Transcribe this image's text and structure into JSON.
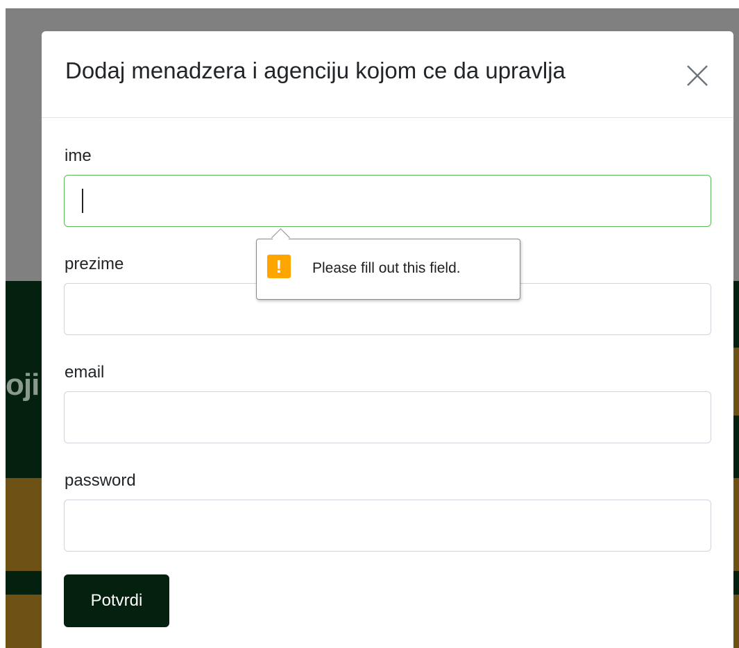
{
  "background": {
    "partial_heading": "oji"
  },
  "modal": {
    "title": "Dodaj menadzera i agenciju kojom ce da upravlja",
    "close_icon": "close-icon",
    "fields": [
      {
        "label": "ime",
        "value": "",
        "focused": true
      },
      {
        "label": "prezime",
        "value": ""
      },
      {
        "label": "email",
        "value": ""
      },
      {
        "label": "password",
        "value": ""
      }
    ],
    "submit_label": "Potvrdi"
  },
  "validation_tooltip": {
    "icon": "warning-icon",
    "icon_symbol": "!",
    "message": "Please fill out this field."
  },
  "colors": {
    "overlay": "#808080",
    "dark_green": "#04200f",
    "gold": "#6e5115",
    "focus_border": "#5cb85c",
    "warning": "#ffa500"
  }
}
